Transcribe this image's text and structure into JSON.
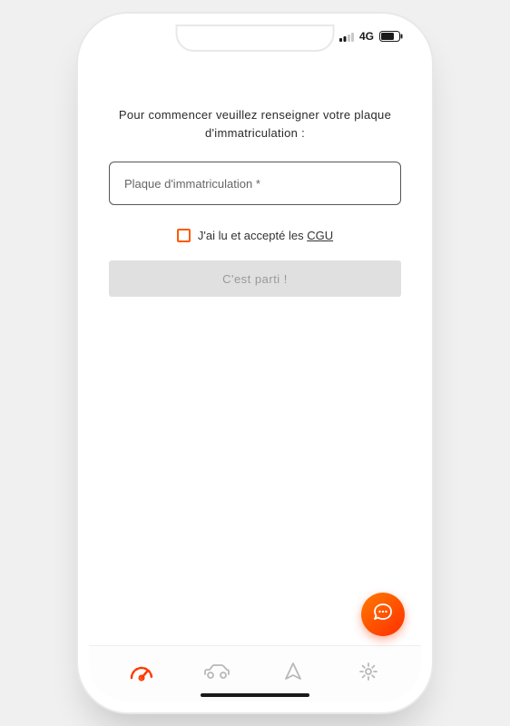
{
  "statusBar": {
    "network": "4G"
  },
  "form": {
    "instruction": "Pour commencer veuillez renseigner votre plaque d'immatriculation :",
    "platePlaceholder": "Plaque d'immatriculation *",
    "plateValue": "",
    "cguPrefix": "J'ai lu et accepté les ",
    "cguLinkText": "CGU",
    "submitLabel": "C'est parti !"
  },
  "nav": {
    "items": [
      {
        "name": "dashboard",
        "active": true
      },
      {
        "name": "vehicle",
        "active": false
      },
      {
        "name": "navigate",
        "active": false
      },
      {
        "name": "settings",
        "active": false
      }
    ]
  },
  "colors": {
    "accent": "#ff5a00",
    "disabledBg": "#e0e0e0",
    "disabledText": "#999999"
  }
}
